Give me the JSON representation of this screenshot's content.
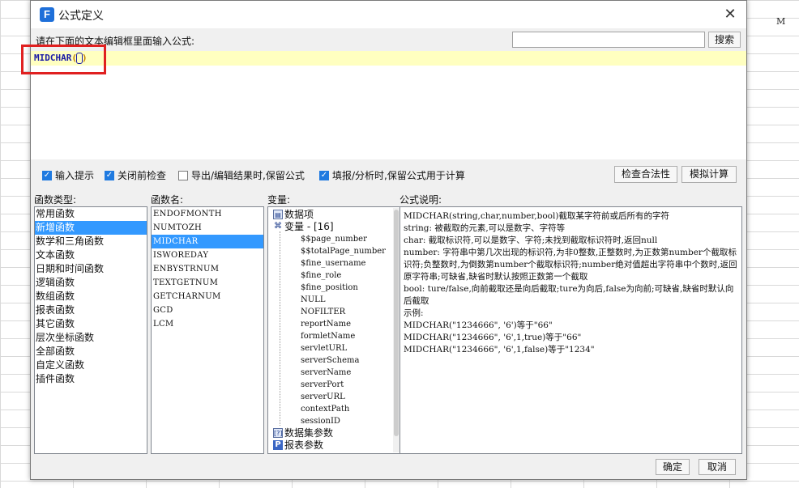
{
  "sheet": {
    "column_letter": "M"
  },
  "dialog": {
    "title": "公式定义",
    "prompt": "请在下面的文本编辑框里面输入公式:",
    "search_value": "",
    "search_button": "搜索",
    "formula": {
      "name": "MIDCHAR",
      "open": "(",
      "close": ")"
    },
    "options": [
      {
        "label": "输入提示",
        "checked": true
      },
      {
        "label": "关闭前检查",
        "checked": true
      },
      {
        "label": "导出/编辑结果时,保留公式",
        "checked": false
      },
      {
        "label": "填报/分析时,保留公式用于计算",
        "checked": true
      }
    ],
    "check_button": "检查合法性",
    "simulate_button": "模拟计算",
    "labels": {
      "types": "函数类型:",
      "names": "函数名:",
      "vars": "变量:",
      "desc": "公式说明:"
    },
    "function_types": [
      "常用函数",
      "新增函数",
      "数学和三角函数",
      "文本函数",
      "日期和时间函数",
      "逻辑函数",
      "数组函数",
      "报表函数",
      "其它函数",
      "层次坐标函数",
      "全部函数",
      "自定义函数",
      "插件函数"
    ],
    "function_types_selected": 1,
    "function_names": [
      "ENDOFMONTH",
      "NUMTOZH",
      "MIDCHAR",
      "ISWOREDAY",
      "ENBYSTRNUM",
      "TEXTGETNUM",
      "GETCHARNUM",
      "GCD",
      "LCM"
    ],
    "function_names_selected": 2,
    "variables": {
      "data_item": "数据项",
      "var_group": "变量 - [16]",
      "items": [
        "$$page_number",
        "$$totalPage_number",
        "$fine_username",
        "$fine_role",
        "$fine_position",
        "NULL",
        "NOFILTER",
        "reportName",
        "formletName",
        "servletURL",
        "serverSchema",
        "serverName",
        "serverPort",
        "serverURL",
        "contextPath",
        "sessionID"
      ],
      "dataset_params": "数据集参数",
      "report_params": "报表参数"
    },
    "description": [
      "MIDCHAR(string,char,number,bool)截取某字符前或后所有的字符",
      "string: 被截取的元素,可以是数字、字符等",
      "char: 截取标识符,可以是数字、字符;未找到截取标识符时,返回null",
      "number: 字符串中第几次出现的标识符,为非0整数,正整数时,为正数第number个截取标识符;负整数时,为倒数第number个截取标识符;number绝对值超出字符串中个数时,返回原字符串;可缺省,缺省时默认按照正数第一个截取",
      "bool: ture/false,向前截取还是向后截取;ture为向后,false为向前;可缺省,缺省时默认向后截取",
      "示例:",
      "MIDCHAR(\"1234666\", '6')等于\"66\"",
      "MIDCHAR(\"1234666\", '6',1,true)等于\"66\"",
      "MIDCHAR(\"1234666\", '6',1,false)等于\"1234\""
    ],
    "ok_button": "确定",
    "cancel_button": "取消",
    "colors": {
      "accent": "#3399ff",
      "highlight": "#e02020",
      "editor_line": "#ffffc0"
    }
  }
}
